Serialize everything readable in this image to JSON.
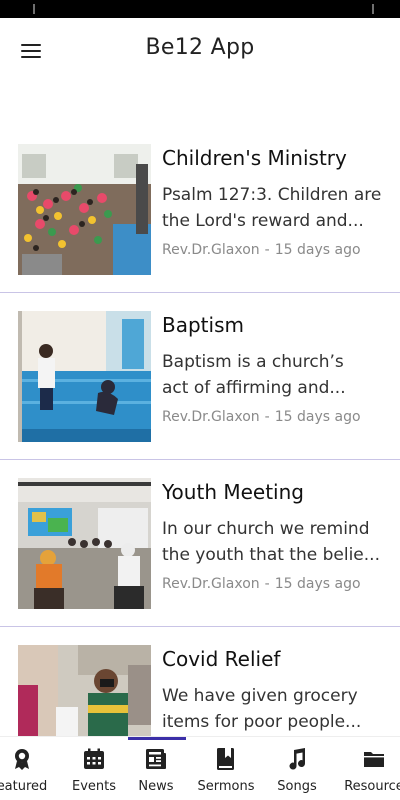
{
  "app": {
    "title": "Be12 App"
  },
  "posts": [
    {
      "title": "Children's Ministry",
      "excerpt_line1": "Psalm 127:3. Children are",
      "excerpt_line2": "the Lord's reward and...",
      "author": "Rev.Dr.Glaxon",
      "separator": "-",
      "time": "15 days ago",
      "image": "children-ministry-photo"
    },
    {
      "title": "Baptism",
      "excerpt_line1": "Baptism is a church’s",
      "excerpt_line2": "act of affirming and...",
      "author": "Rev.Dr.Glaxon",
      "separator": "-",
      "time": "15 days ago",
      "image": "baptism-photo"
    },
    {
      "title": "Youth Meeting",
      "excerpt_line1": "In our church we remind",
      "excerpt_line2": "the youth that the belie...",
      "author": "Rev.Dr.Glaxon",
      "separator": "-",
      "time": "15 days ago",
      "image": "youth-meeting-photo"
    },
    {
      "title": "Covid Relief",
      "excerpt_line1": "We have given grocery",
      "excerpt_line2": "items for poor people...",
      "author": "",
      "separator": "",
      "time": "",
      "image": "covid-relief-photo"
    }
  ],
  "nav": {
    "active": "News",
    "items": [
      {
        "label": "Featured",
        "display": "eatured",
        "icon": "award-icon"
      },
      {
        "label": "Events",
        "display": "Events",
        "icon": "calendar-icon"
      },
      {
        "label": "News",
        "display": "News",
        "icon": "newspaper-icon"
      },
      {
        "label": "Sermons",
        "display": "Sermons",
        "icon": "bookmark-book-icon"
      },
      {
        "label": "Songs",
        "display": "Songs",
        "icon": "music-note-icon"
      },
      {
        "label": "Resources",
        "display": "Resource",
        "icon": "folder-icon"
      }
    ]
  },
  "colors": {
    "accent": "#3b2fa8",
    "divider": "#c9c4e6",
    "meta": "#8a8a8a"
  }
}
